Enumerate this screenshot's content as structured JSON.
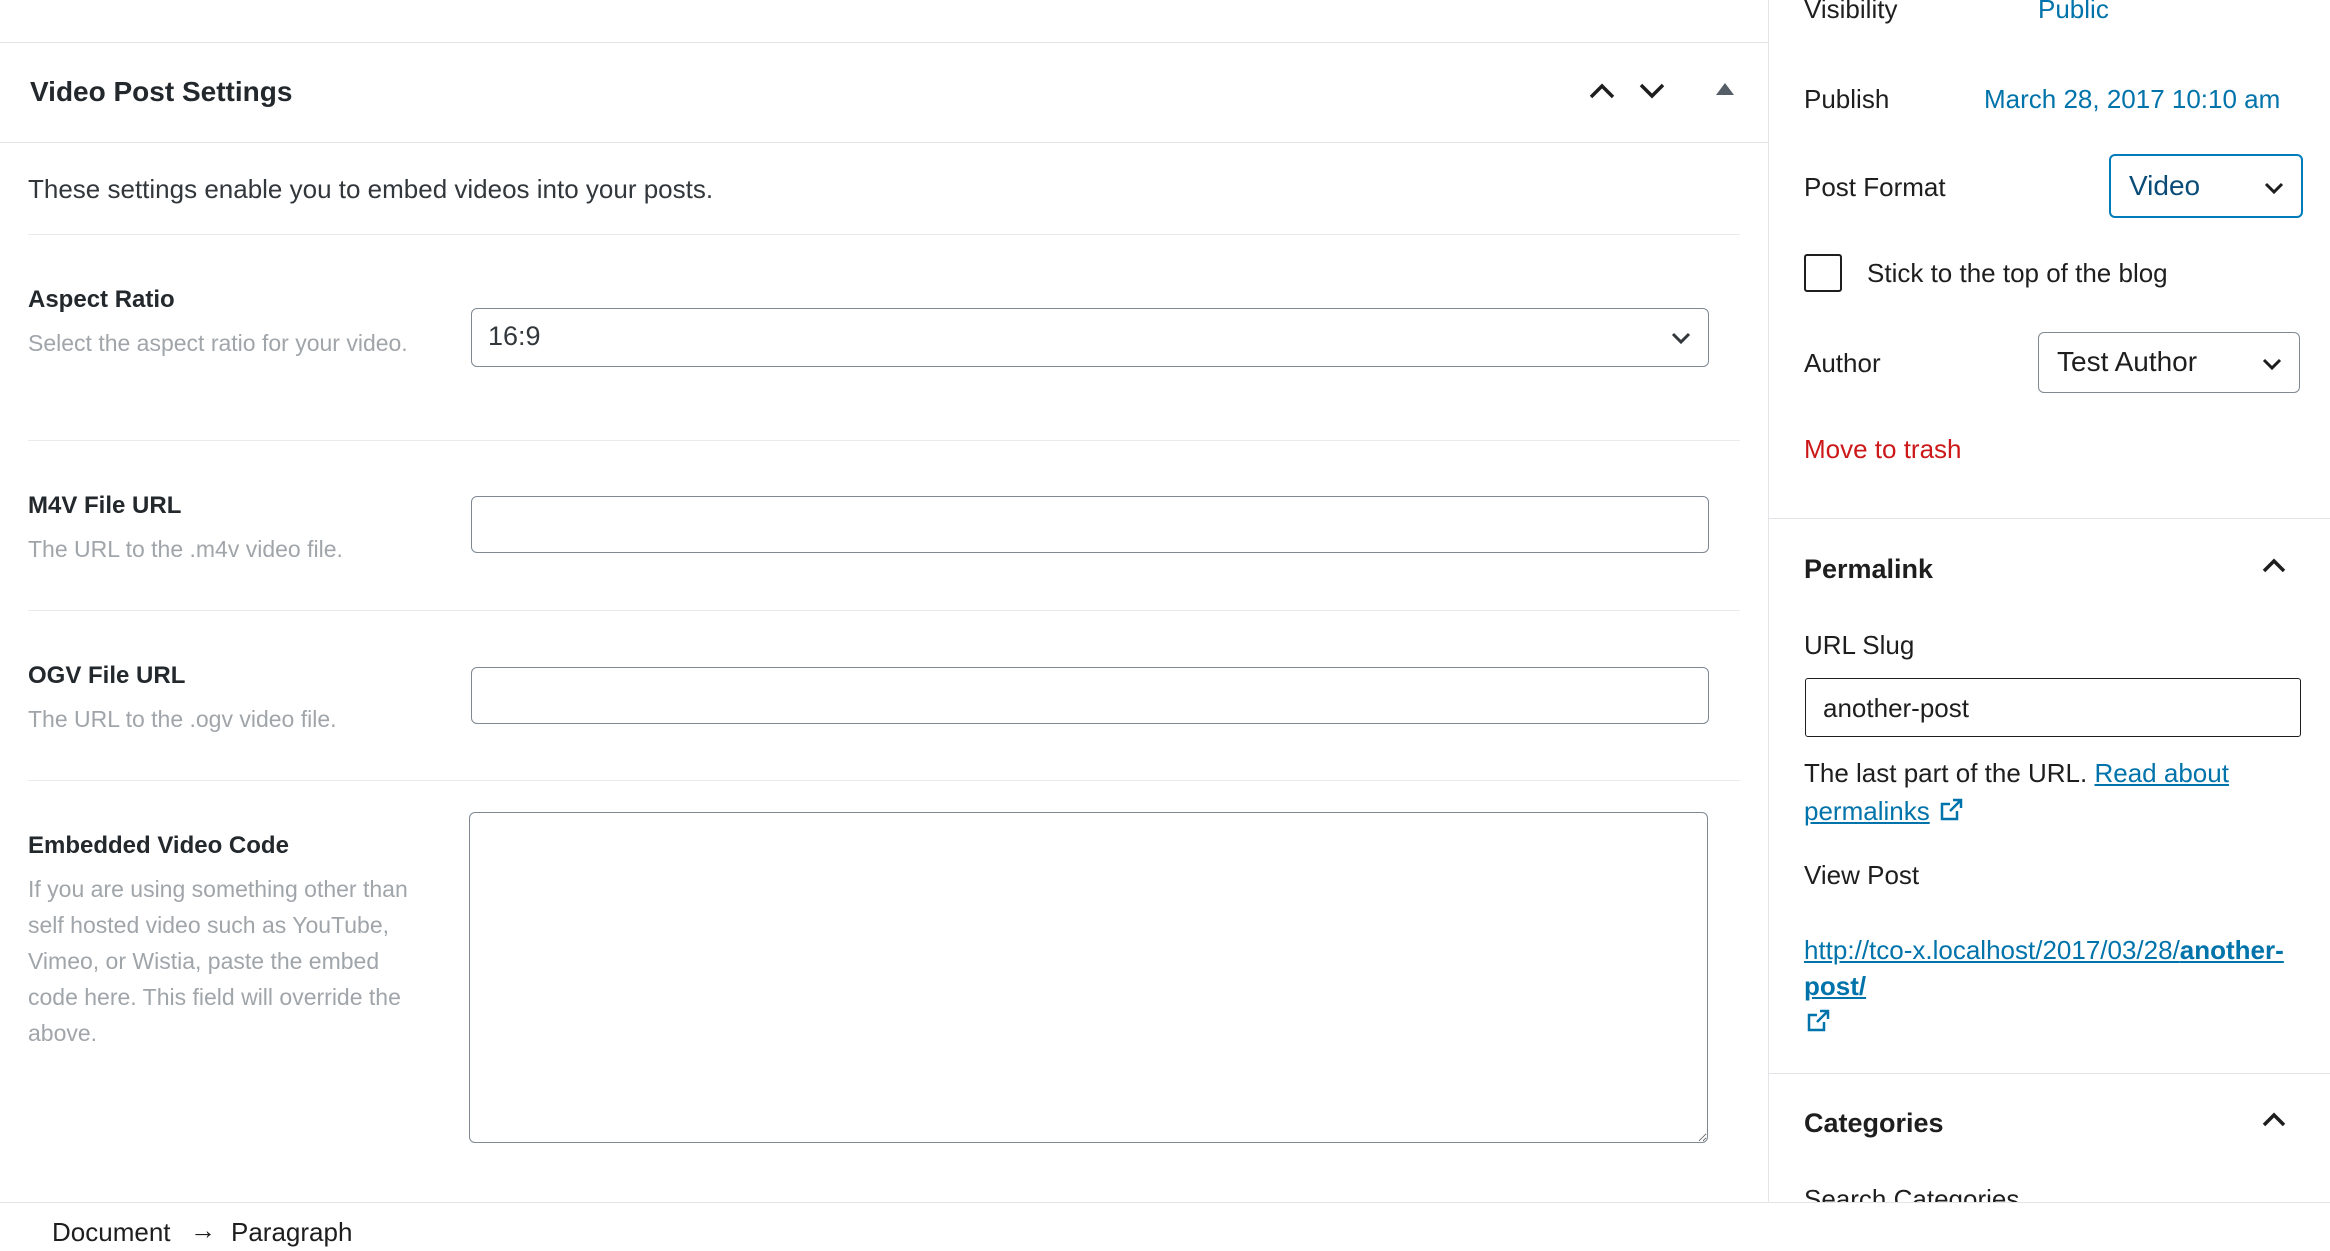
{
  "video_panel": {
    "title": "Video Post Settings",
    "intro": "These settings enable you to embed videos into your posts.",
    "fields": [
      {
        "label": "Aspect Ratio",
        "description": "Select the aspect ratio for your video.",
        "value": "16:9"
      },
      {
        "label": "M4V File URL",
        "description": "The URL to the .m4v video file.",
        "value": ""
      },
      {
        "label": "OGV File URL",
        "description": "The URL to the .ogv video file.",
        "value": ""
      },
      {
        "label": "Embedded Video Code",
        "description": "If you are using something other than self hosted video such as YouTube, Vimeo, or Wistia, paste the embed code here. This field will override the above.",
        "value": ""
      }
    ]
  },
  "sidebar": {
    "visibility": {
      "label": "Visibility",
      "value": "Public"
    },
    "publish": {
      "label": "Publish",
      "value": "March 28, 2017 10:10 am"
    },
    "post_format": {
      "label": "Post Format",
      "value": "Video"
    },
    "sticky": {
      "label": "Stick to the top of the blog",
      "checked": false
    },
    "author": {
      "label": "Author",
      "value": "Test Author"
    },
    "trash_label": "Move to trash",
    "permalink": {
      "title": "Permalink",
      "slug_label": "URL Slug",
      "slug_value": "another-post",
      "help_text": "The last part of the URL.",
      "help_link": "Read about permalinks",
      "view_label": "View Post",
      "url_base": "http://tco-x.localhost/2017/03/28/",
      "url_slug": "another-post/"
    },
    "categories": {
      "title": "Categories",
      "search_label": "Search Categories"
    }
  },
  "breadcrumbs": [
    "Document",
    "Paragraph"
  ],
  "colors": {
    "link": "#0073aa",
    "danger": "#cc1818",
    "focus": "#007cba"
  }
}
